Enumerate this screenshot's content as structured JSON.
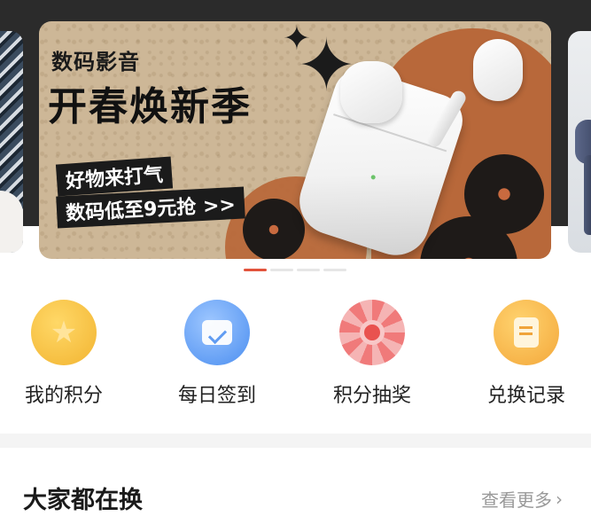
{
  "banner": {
    "subtitle": "数码影音",
    "title": "开春焕新季",
    "tag_1": "好物来打气",
    "tag_2": "数码低至9元抢 >>"
  },
  "carousel": {
    "total": 4,
    "active_index": 0
  },
  "actions": [
    {
      "label": "我的积分",
      "icon": "star-icon"
    },
    {
      "label": "每日签到",
      "icon": "calendar-check-icon"
    },
    {
      "label": "积分抽奖",
      "icon": "lottery-wheel-icon"
    },
    {
      "label": "兑换记录",
      "icon": "document-icon"
    }
  ],
  "section": {
    "title": "大家都在换",
    "more": "查看更多"
  },
  "colors": {
    "accent": "#e2533c"
  }
}
